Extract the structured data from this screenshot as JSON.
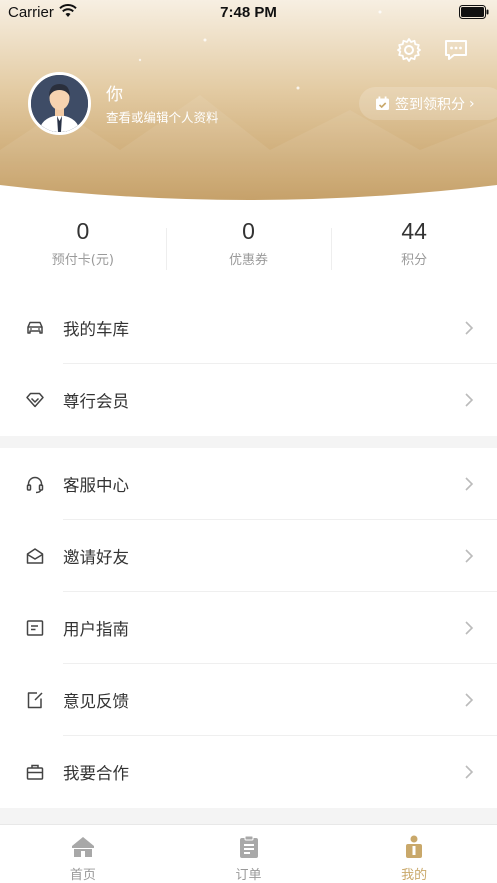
{
  "status_bar": {
    "carrier": "Carrier",
    "time": "7:48 PM"
  },
  "profile": {
    "name": "你",
    "subtitle": "查看或编辑个人资料",
    "checkin_label": "签到领积分",
    "checkin_chevron": "›"
  },
  "header_icons": [
    "gear-icon",
    "message-icon"
  ],
  "stats": [
    {
      "value": "0",
      "label": "预付卡(元)"
    },
    {
      "value": "0",
      "label": "优惠券"
    },
    {
      "value": "44",
      "label": "积分"
    }
  ],
  "menu_group_1": [
    {
      "label": "我的车库",
      "icon": "car-icon"
    },
    {
      "label": "尊行会员",
      "icon": "diamond-icon"
    }
  ],
  "menu_group_2": [
    {
      "label": "客服中心",
      "icon": "headset-icon"
    },
    {
      "label": "邀请好友",
      "icon": "mail-icon"
    },
    {
      "label": "用户指南",
      "icon": "guide-icon"
    },
    {
      "label": "意见反馈",
      "icon": "feedback-icon"
    },
    {
      "label": "我要合作",
      "icon": "briefcase-icon"
    }
  ],
  "tabbar": [
    {
      "label": "首页",
      "icon": "home-icon",
      "active": false
    },
    {
      "label": "订单",
      "icon": "order-icon",
      "active": false
    },
    {
      "label": "我的",
      "icon": "profile-icon",
      "active": true
    }
  ],
  "colors": {
    "gold": "#c9a86a",
    "gold_light": "#f4ead8",
    "text": "#333333",
    "muted": "#9a9a9a"
  }
}
